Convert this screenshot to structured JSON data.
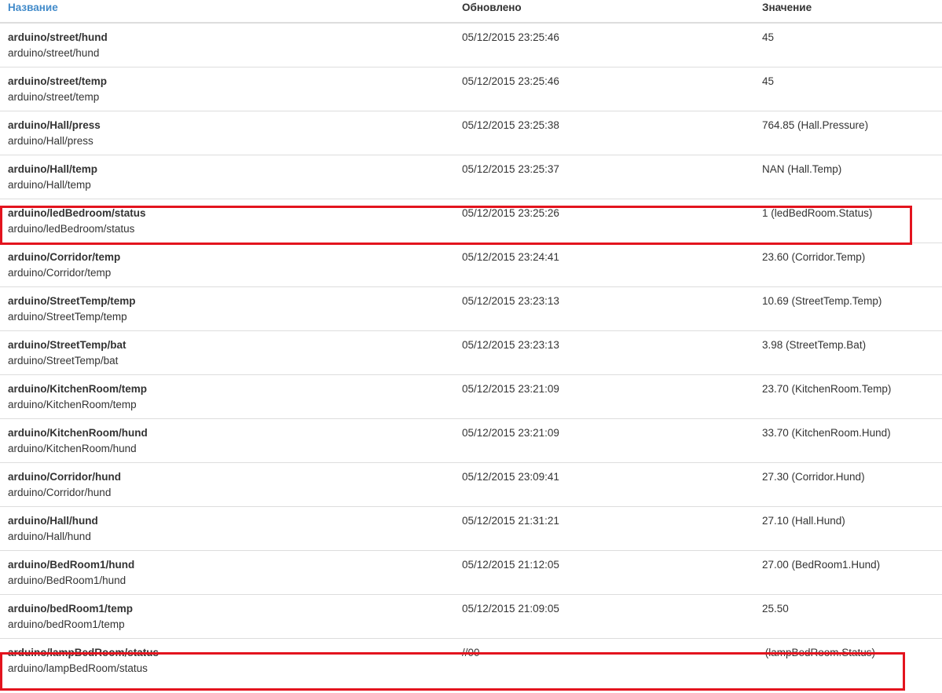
{
  "table": {
    "headers": {
      "name": "Название",
      "updated": "Обновлено",
      "value": "Значение"
    },
    "rows": [
      {
        "title": "arduino/street/hund",
        "path": "arduino/street/hund",
        "updated": "05/12/2015 23:25:46",
        "value": "45"
      },
      {
        "title": "arduino/street/temp",
        "path": "arduino/street/temp",
        "updated": "05/12/2015 23:25:46",
        "value": "45"
      },
      {
        "title": "arduino/Hall/press",
        "path": "arduino/Hall/press",
        "updated": "05/12/2015 23:25:38",
        "value": "764.85 (Hall.Pressure)"
      },
      {
        "title": "arduino/Hall/temp",
        "path": "arduino/Hall/temp",
        "updated": "05/12/2015 23:25:37",
        "value": "NAN (Hall.Temp)"
      },
      {
        "title": "arduino/ledBedroom/status",
        "path": "arduino/ledBedroom/status",
        "updated": "05/12/2015 23:25:26",
        "value": "1 (ledBedRoom.Status)"
      },
      {
        "title": "arduino/Corridor/temp",
        "path": "arduino/Corridor/temp",
        "updated": "05/12/2015 23:24:41",
        "value": "23.60 (Corridor.Temp)"
      },
      {
        "title": "arduino/StreetTemp/temp",
        "path": "arduino/StreetTemp/temp",
        "updated": "05/12/2015 23:23:13",
        "value": "10.69 (StreetTemp.Temp)"
      },
      {
        "title": "arduino/StreetTemp/bat",
        "path": "arduino/StreetTemp/bat",
        "updated": "05/12/2015 23:23:13",
        "value": "3.98 (StreetTemp.Bat)"
      },
      {
        "title": "arduino/KitchenRoom/temp",
        "path": "arduino/KitchenRoom/temp",
        "updated": "05/12/2015 23:21:09",
        "value": "23.70 (KitchenRoom.Temp)"
      },
      {
        "title": "arduino/KitchenRoom/hund",
        "path": "arduino/KitchenRoom/hund",
        "updated": "05/12/2015 23:21:09",
        "value": "33.70 (KitchenRoom.Hund)"
      },
      {
        "title": "arduino/Corridor/hund",
        "path": "arduino/Corridor/hund",
        "updated": "05/12/2015 23:09:41",
        "value": "27.30 (Corridor.Hund)"
      },
      {
        "title": "arduino/Hall/hund",
        "path": "arduino/Hall/hund",
        "updated": "05/12/2015 21:31:21",
        "value": "27.10 (Hall.Hund)"
      },
      {
        "title": "arduino/BedRoom1/hund",
        "path": "arduino/BedRoom1/hund",
        "updated": "05/12/2015 21:12:05",
        "value": "27.00 (BedRoom1.Hund)"
      },
      {
        "title": "arduino/bedRoom1/temp",
        "path": "arduino/bedRoom1/temp",
        "updated": "05/12/2015 21:09:05",
        "value": "25.50"
      },
      {
        "title": "arduino/lampBedRoom/status",
        "path": "arduino/lampBedRoom/status",
        "updated": "//00",
        "value": " (lampBedRoom.Status)"
      }
    ]
  },
  "colors": {
    "link": "#428bca",
    "highlight": "#e3141e",
    "border": "#dddddd"
  }
}
